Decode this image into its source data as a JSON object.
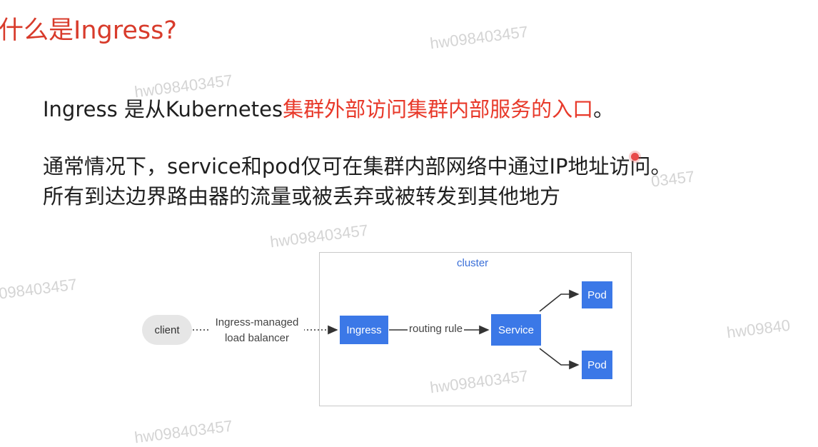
{
  "title": "什么是Ingress?",
  "intro": {
    "prefix": "Ingress 是从Kubernetes",
    "highlight": "集群外部访问集群内部服务的入口",
    "suffix": "。"
  },
  "paragraph_line1": "通常情况下，service和pod仅可在集群内部网络中通过IP地址访问。",
  "paragraph_line2": "所有到达边界路由器的流量或被丢弃或被转发到其他地方",
  "watermark": "hw098403457",
  "watermark_partial_1": "098403457",
  "watermark_partial_2": "hw09840",
  "watermark_partial_3": "03457",
  "diagram": {
    "cluster_label": "cluster",
    "client": "client",
    "lb_label_line1": "Ingress-managed",
    "lb_label_line2": "load balancer",
    "ingress": "Ingress",
    "routing_rule": "routing rule",
    "service": "Service",
    "pod_top": "Pod",
    "pod_bottom": "Pod"
  },
  "colors": {
    "title_red": "#d83b2b",
    "highlight_red": "#e8392a",
    "node_blue": "#3b78e7",
    "client_gray": "#e6e6e6"
  }
}
